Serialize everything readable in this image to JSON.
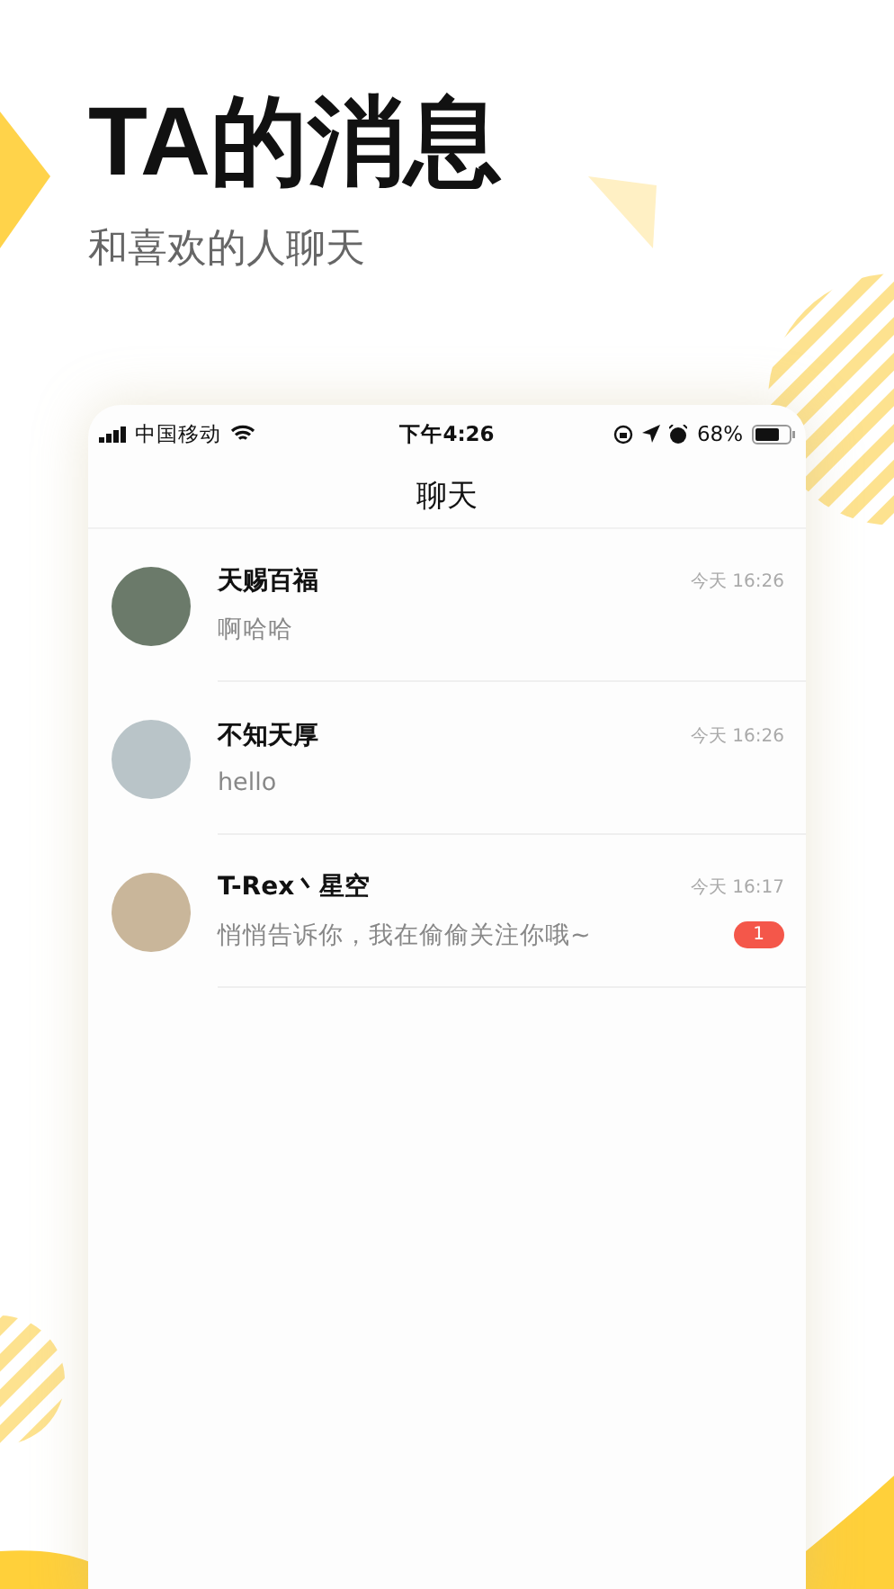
{
  "headline": {
    "title": "TA的消息",
    "subtitle": "和喜欢的人聊天"
  },
  "status_bar": {
    "carrier": "中国移动",
    "time": "下午4:26",
    "battery": "68%"
  },
  "nav": {
    "title": "聊天"
  },
  "chats": [
    {
      "name": "天赐百福",
      "preview": "啊哈哈",
      "time": "今天 16:26"
    },
    {
      "name": "不知天厚",
      "preview": "hello",
      "time": "今天 16:26"
    },
    {
      "name": "T-Rex丶星空",
      "preview": "悄悄告诉你，我在偷偷关注你哦~",
      "time": "今天 16:17",
      "unread": "1"
    }
  ]
}
